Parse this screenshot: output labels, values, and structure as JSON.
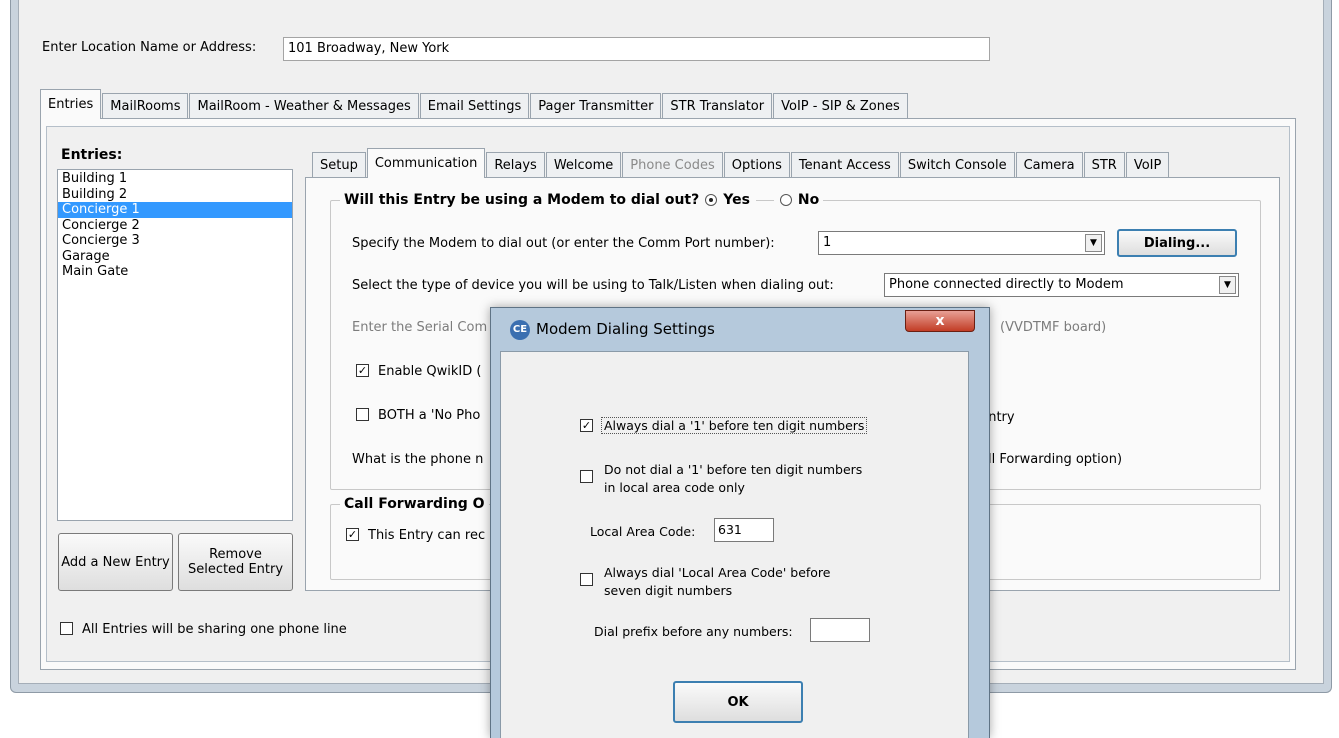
{
  "location": {
    "label": "Enter Location Name or Address:",
    "value": "101 Broadway, New York"
  },
  "outer_tabs": [
    "Entries",
    "MailRooms",
    "MailRoom - Weather & Messages",
    "Email Settings",
    "Pager Transmitter",
    "STR Translator",
    "VoIP - SIP & Zones"
  ],
  "entries": {
    "title": "Entries:",
    "items": [
      "Building 1",
      "Building 2",
      "Concierge 1",
      "Concierge 2",
      "Concierge 3",
      "Garage",
      "Main Gate"
    ],
    "selected": "Concierge 1",
    "add_label": "Add a New Entry",
    "remove_label": "Remove Selected Entry",
    "share_label": "All Entries will be sharing one phone line"
  },
  "inner_tabs": [
    "Setup",
    "Communication",
    "Relays",
    "Welcome",
    "Phone Codes",
    "Options",
    "Tenant Access",
    "Switch Console",
    "Camera",
    "STR",
    "VoIP"
  ],
  "communication": {
    "modem_question": "Will this Entry be using a Modem to dial out?",
    "yes_label": "Yes",
    "no_label": "No",
    "modem_label": "Specify the Modem to dial out (or enter the Comm Port number):",
    "modem_value": "1",
    "dialing_button": "Dialing...",
    "device_label": "Select the type of device you will be using to Talk/Listen when dialing out:",
    "device_value": "Phone connected directly to Modem",
    "serial_label_left": "Enter the Serial Com",
    "serial_label_right": "(VVDTMF board)",
    "qwikid_label": "Enable QwikID (",
    "both_label": "BOTH a 'No Pho",
    "both_label_right": "Entry",
    "phone_label": "What is the phone n",
    "phone_label_right": "all Forwarding option)",
    "cf_title": "Call Forwarding O",
    "cf_label": "This Entry can rec"
  },
  "dialog": {
    "title": "Modem Dialing Settings",
    "close": "x",
    "always_dial_1": "Always dial a '1' before ten digit numbers",
    "do_not_dial_1_line1": "Do not dial a '1' before ten digit numbers",
    "do_not_dial_1_line2": "in local area code only",
    "local_area_code_label": "Local Area Code:",
    "local_area_code_value": "631",
    "always_dial_area_line1": "Always dial 'Local Area Code' before",
    "always_dial_area_line2": "seven digit numbers",
    "dial_prefix_label": "Dial prefix before any numbers:",
    "dial_prefix_value": "",
    "ok_label": "OK"
  }
}
